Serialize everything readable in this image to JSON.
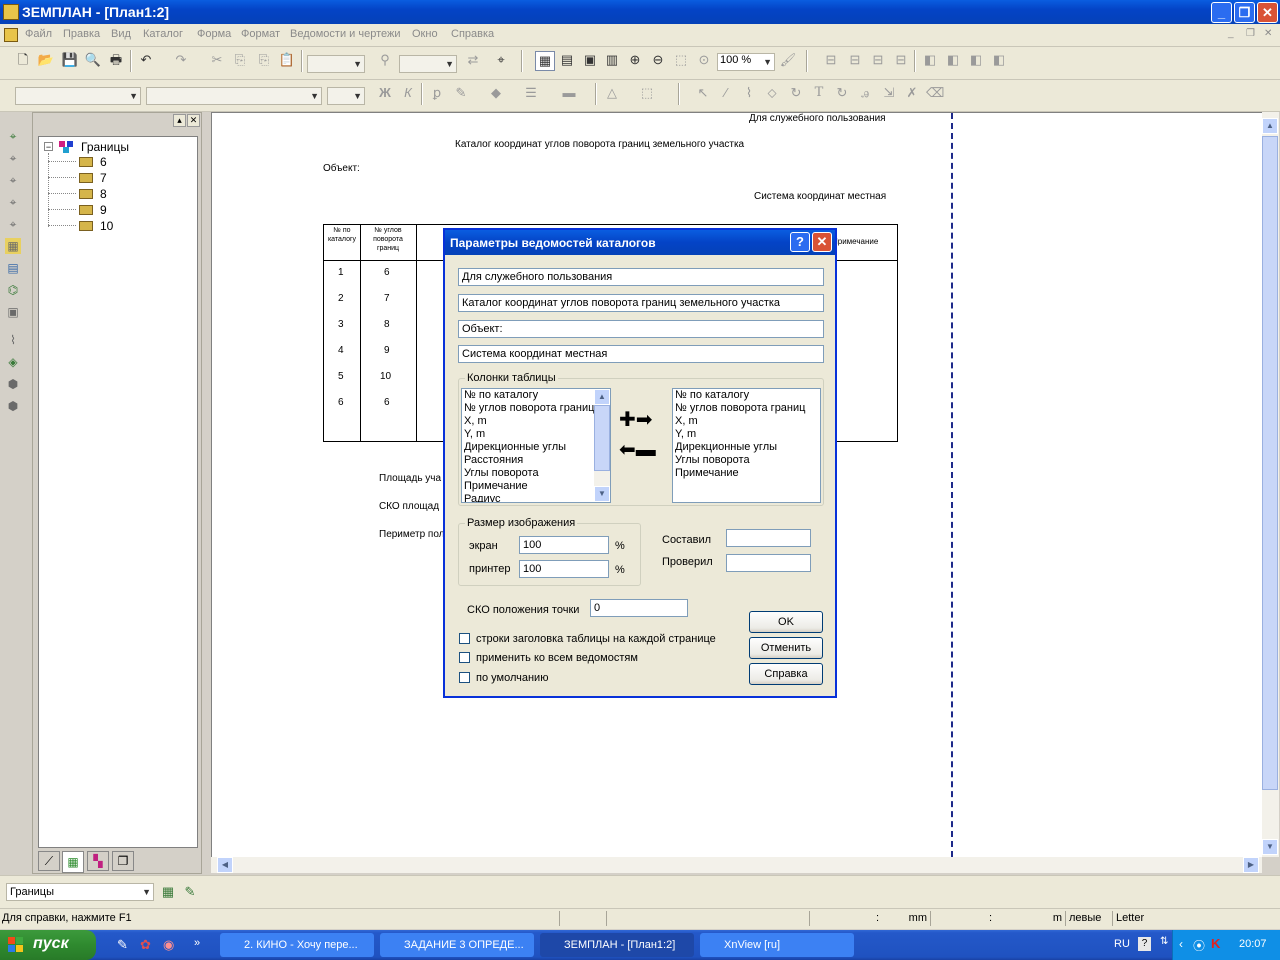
{
  "window": {
    "title": "ЗЕМПЛАН - [План1:2]"
  },
  "menu": {
    "items": [
      "Файл",
      "Правка",
      "Вид",
      "Каталог",
      "Форма",
      "Формат",
      "Ведомости и чертежи",
      "Окно",
      "Справка"
    ]
  },
  "toolbar": {
    "zoom": "100 %"
  },
  "tree": {
    "root": "Границы",
    "children": [
      "6",
      "7",
      "8",
      "9",
      "10"
    ]
  },
  "layer_combo": {
    "value": "Границы"
  },
  "document": {
    "service_note": "Для служебного пользования",
    "catalog_title": "Каталог координат углов поворота границ земельного участка",
    "object_label": "Объект:",
    "coord_system": "Система координат местная",
    "table": {
      "col1_header": "№ по каталогу",
      "col2_header": "№ углов поворота границ",
      "col_last_header": "Примечание",
      "col1_values": [
        "1",
        "2",
        "3",
        "4",
        "5",
        "6"
      ],
      "col2_values": [
        "6",
        "7",
        "8",
        "9",
        "10",
        "6"
      ]
    },
    "area_label": "Площадь уча",
    "sko_area_label": "СКО площад",
    "perimeter_label": "Периметр пол"
  },
  "dialog": {
    "title": "Параметры ведомостей каталогов",
    "field1": "Для служебного пользования",
    "field2": "Каталог координат углов поворота границ земельного участка",
    "field3": "Объект:",
    "field4": "Система координат местная",
    "columns_group": "Колонки таблицы",
    "available_columns": [
      "№ по каталогу",
      "№ углов поворота границ",
      "X, m",
      "Y, m",
      "Дирекционные углы",
      "Расстояния",
      "Углы поворота",
      "Примечание",
      "Радиус"
    ],
    "selected_columns": [
      "№ по каталогу",
      "№ углов поворота границ",
      "X, m",
      "Y, m",
      "Дирекционные углы",
      "Углы поворота",
      "Примечание"
    ],
    "size_group": "Размер изображения",
    "screen_label": "экран",
    "screen_value": "100",
    "printer_label": "принтер",
    "printer_value": "100",
    "percent": "%",
    "composed_label": "Составил",
    "composed_value": "",
    "checked_label": "Проверил",
    "checked_value": "",
    "sko_label": "СКО положения точки",
    "sko_value": "0",
    "chk1": "строки заголовка таблицы на каждой странице",
    "chk2": "применить ко всем ведомостям",
    "chk3": "по умолчанию",
    "ok": "OK",
    "cancel": "Отменить",
    "help": "Справка"
  },
  "status": {
    "help_text": "Для справки, нажмите F1",
    "colon1": ":",
    "unit1": "mm",
    "colon2": ":",
    "unit2": "m",
    "fields": "левые",
    "paper": "Letter"
  },
  "taskbar": {
    "start": "пуск",
    "tasks": [
      "2. КИНО - Хочу пере...",
      "ЗАДАНИЕ 3 ОПРЕДЕ...",
      "ЗЕМПЛАН - [План1:2]",
      "XnView [ru]"
    ],
    "lang": "RU",
    "time": "20:07"
  }
}
